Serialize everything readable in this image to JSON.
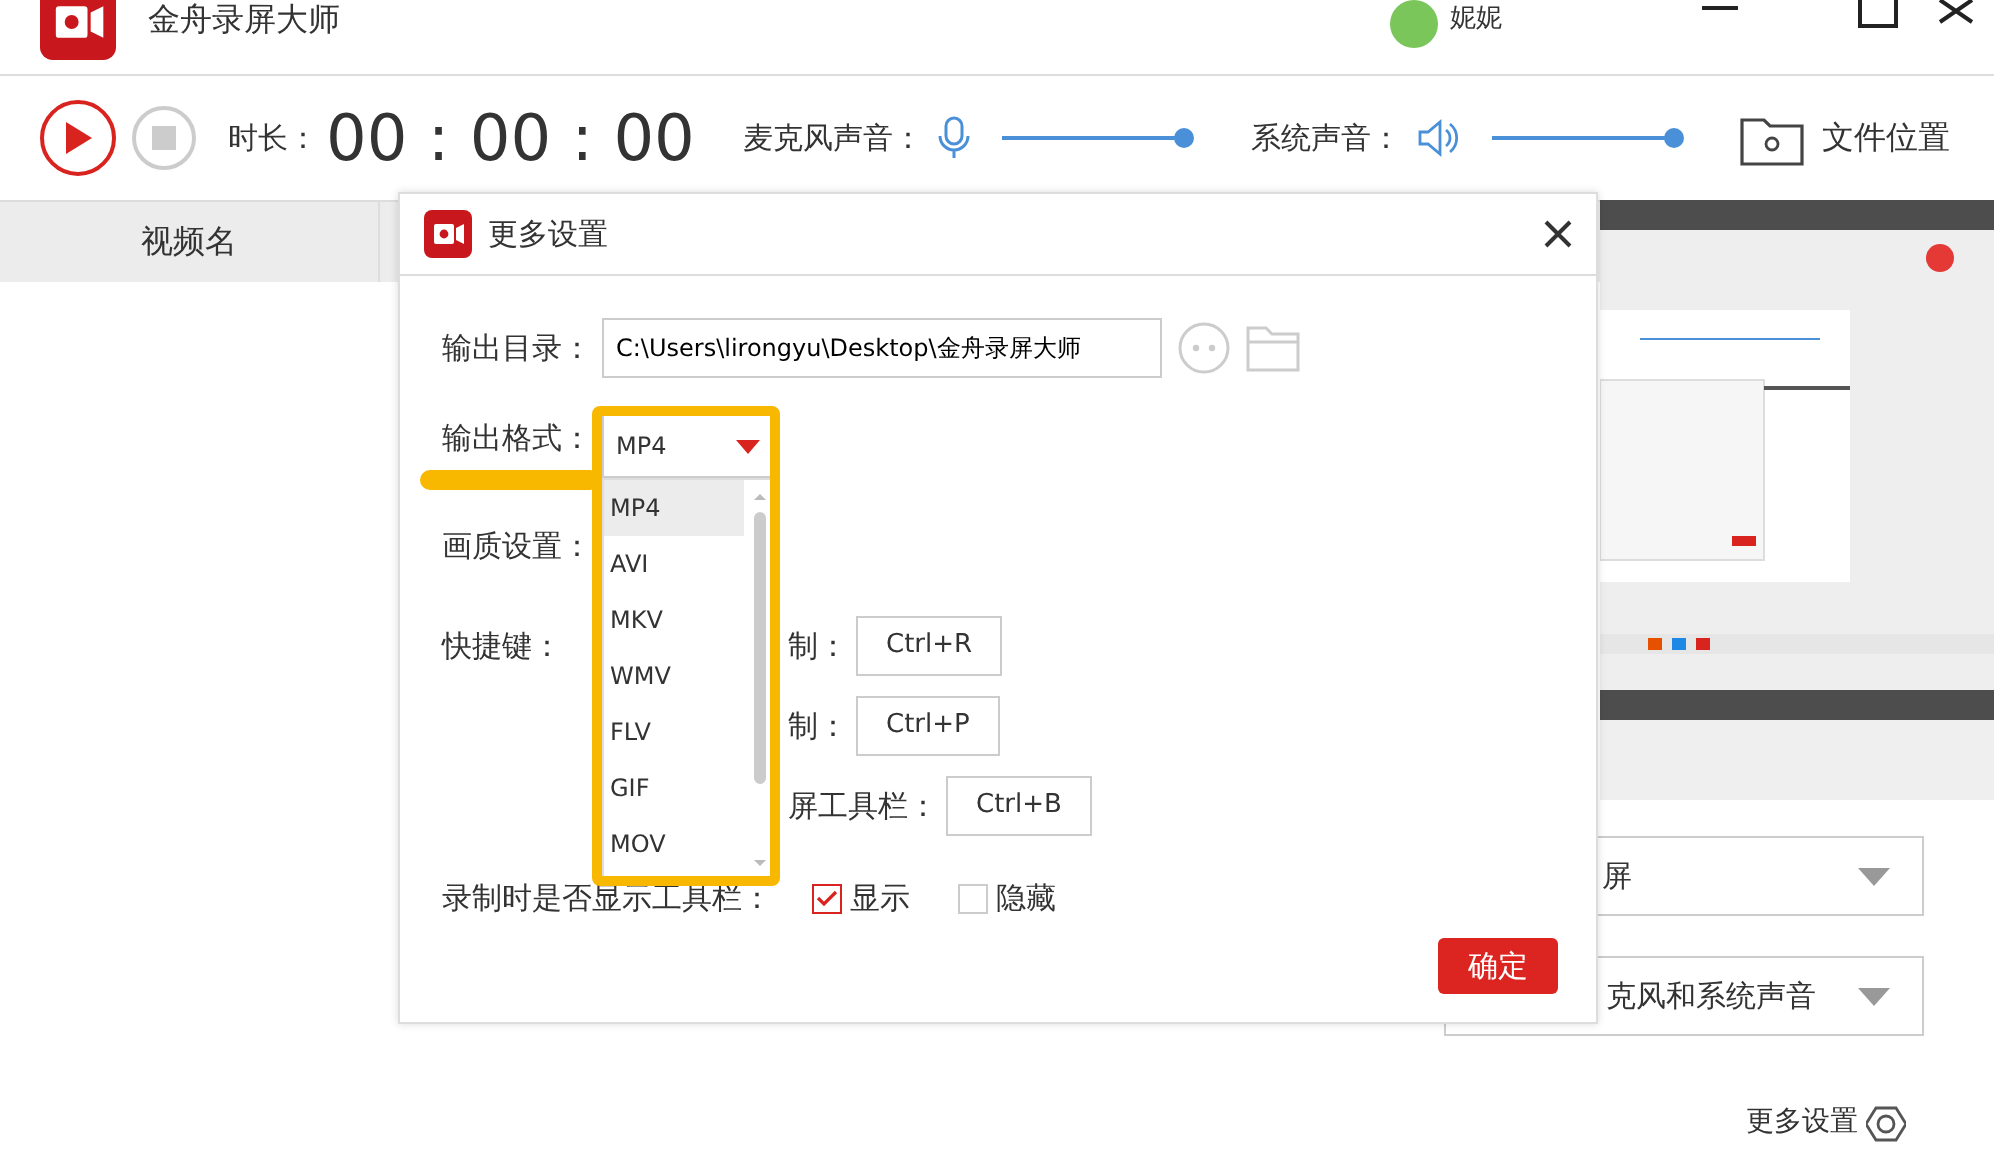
{
  "app": {
    "title": "金舟录屏大师",
    "user": "妮妮"
  },
  "toolbar": {
    "duration_label": "时长：",
    "duration": "00 : 00 : 00",
    "mic_label": "麦克风声音：",
    "mic": {
      "level": 1
    },
    "system_label": "系统声音：",
    "system": {
      "level": 1
    },
    "file_location": "文件位置"
  },
  "list": {
    "columns": [
      "视频名"
    ]
  },
  "right_panel": {
    "selects": [
      {
        "value": "屏"
      },
      {
        "value": "克风和系统声音"
      }
    ],
    "more_settings": "更多设置"
  },
  "dialog": {
    "title": "更多设置",
    "output_dir_label": "输出目录：",
    "output_dir": "C:\\Users\\lirongyu\\Desktop\\金舟录屏大师",
    "format_label": "输出格式：",
    "format": "MP4",
    "format_options": [
      {
        "label": "MP4",
        "selected": true
      },
      {
        "label": "AVI",
        "selected": false
      },
      {
        "label": "MKV",
        "selected": false
      },
      {
        "label": "WMV",
        "selected": false
      },
      {
        "label": "FLV",
        "selected": false
      },
      {
        "label": "GIF",
        "selected": false
      },
      {
        "label": "MOV",
        "selected": false
      }
    ],
    "quality_label": "画质设置：",
    "hotkeys_label": "快捷键：",
    "hotkeys": [
      {
        "label": "制：",
        "key": "Ctrl+R"
      },
      {
        "label": "制：",
        "key": "Ctrl+P"
      },
      {
        "label": "屏工具栏：",
        "key": "Ctrl+B"
      }
    ],
    "toolbar_question": "录制时是否显示工具栏：",
    "toolbar_options": [
      {
        "label": "显示",
        "checked": true
      },
      {
        "label": "隐藏",
        "checked": false
      }
    ],
    "ok": "确定"
  }
}
